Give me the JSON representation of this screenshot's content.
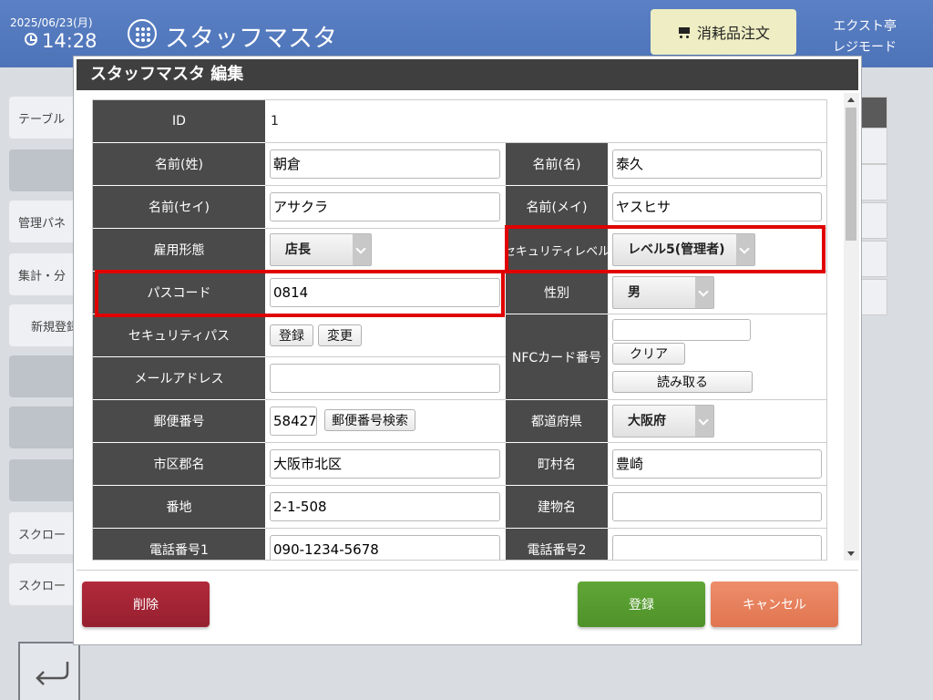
{
  "header": {
    "date": "2025/06/23(月)",
    "time": "14:28",
    "app_title": "スタッフマスタ",
    "order_button": "消耗品注文",
    "store_name": "エクスト亭",
    "mode": "レジモード"
  },
  "background_menu": {
    "items": [
      "テーブル",
      "",
      "管理パネ",
      "集計・分",
      "新規登録",
      "",
      "",
      "",
      "スクロー",
      "スクロー"
    ]
  },
  "dialog": {
    "title": "スタッフマスタ 編集",
    "fields": {
      "id_label": "ID",
      "id_value": "1",
      "last_name_label": "名前(姓)",
      "last_name_value": "朝倉",
      "first_name_label": "名前(名)",
      "first_name_value": "泰久",
      "last_kana_label": "名前(セイ)",
      "last_kana_value": "アサクラ",
      "first_kana_label": "名前(メイ)",
      "first_kana_value": "ヤスヒサ",
      "employment_label": "雇用形態",
      "employment_value": "店長",
      "security_level_label": "セキュリティレベル",
      "security_level_value": "レベル5(管理者)",
      "passcode_label": "パスコード",
      "passcode_value": "0814",
      "gender_label": "性別",
      "gender_value": "男",
      "security_pass_label": "セキュリティパス",
      "security_pass_register": "登録",
      "security_pass_change": "変更",
      "nfc_label": "NFCカード番号",
      "nfc_value": "",
      "nfc_clear": "クリア",
      "nfc_read": "読み取る",
      "email_label": "メールアドレス",
      "email_value": "",
      "zip_label": "郵便番号",
      "zip_value": "58427",
      "zip_search": "郵便番号検索",
      "prefecture_label": "都道府県",
      "prefecture_value": "大阪府",
      "city_label": "市区郡名",
      "city_value": "大阪市北区",
      "town_label": "町村名",
      "town_value": "豊崎",
      "address_label": "番地",
      "address_value": "2-1-508",
      "building_label": "建物名",
      "building_value": "",
      "phone1_label": "電話番号1",
      "phone1_value": "090-1234-5678",
      "phone2_label": "電話番号2",
      "phone2_value": ""
    },
    "buttons": {
      "delete": "削除",
      "register": "登録",
      "cancel": "キャンセル"
    }
  },
  "colors": {
    "header": "#4d73b8",
    "label_bg": "#4a4a4a",
    "highlight": "#e00000",
    "delete": "#a52535",
    "register": "#569c30",
    "cancel": "#e8805c"
  }
}
